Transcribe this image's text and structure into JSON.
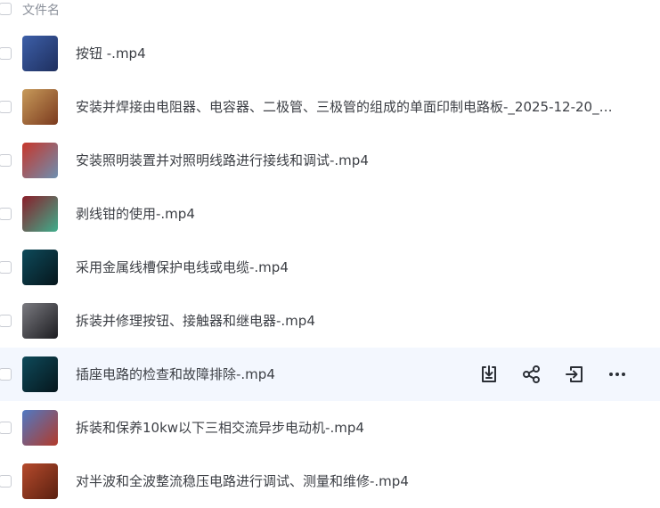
{
  "header": {
    "column_label": "文件名"
  },
  "files": [
    {
      "name": "按钮 -.mp4",
      "thumb": [
        "#3d5fa8",
        "#1e2f5e"
      ]
    },
    {
      "name": "安装并焊接由电阻器、电容器、二极管、三极管的组成的单面印制电路板-_2025-12-20_0...",
      "thumb": [
        "#c79a5a",
        "#7b3a1e"
      ]
    },
    {
      "name": "安装照明装置并对照明线路进行接线和调试-.mp4",
      "thumb": [
        "#c7362b",
        "#6d8fb0"
      ]
    },
    {
      "name": "剥线钳的使用-.mp4",
      "thumb": [
        "#8a1e2a",
        "#3fae8c"
      ]
    },
    {
      "name": "采用金属线槽保护电线或电缆-.mp4",
      "thumb": [
        "#0e4a5a",
        "#06161c"
      ]
    },
    {
      "name": "拆装并修理按钮、接触器和继电器-.mp4",
      "thumb": [
        "#7a7a80",
        "#1c1c20"
      ]
    },
    {
      "name": "插座电路的检查和故障排除-.mp4",
      "thumb": [
        "#0e4a5a",
        "#06161c"
      ]
    },
    {
      "name": "拆装和保养10kw以下三相交流异步电动机-.mp4",
      "thumb": [
        "#4f79c4",
        "#b23a2a"
      ]
    },
    {
      "name": "对半波和全波整流稳压电路进行调试、测量和维修-.mp4",
      "thumb": [
        "#b54a2c",
        "#5a2010"
      ]
    }
  ],
  "hover_row_index": 6,
  "row_actions": [
    "download-icon",
    "share-icon",
    "move-icon",
    "more-icon"
  ]
}
